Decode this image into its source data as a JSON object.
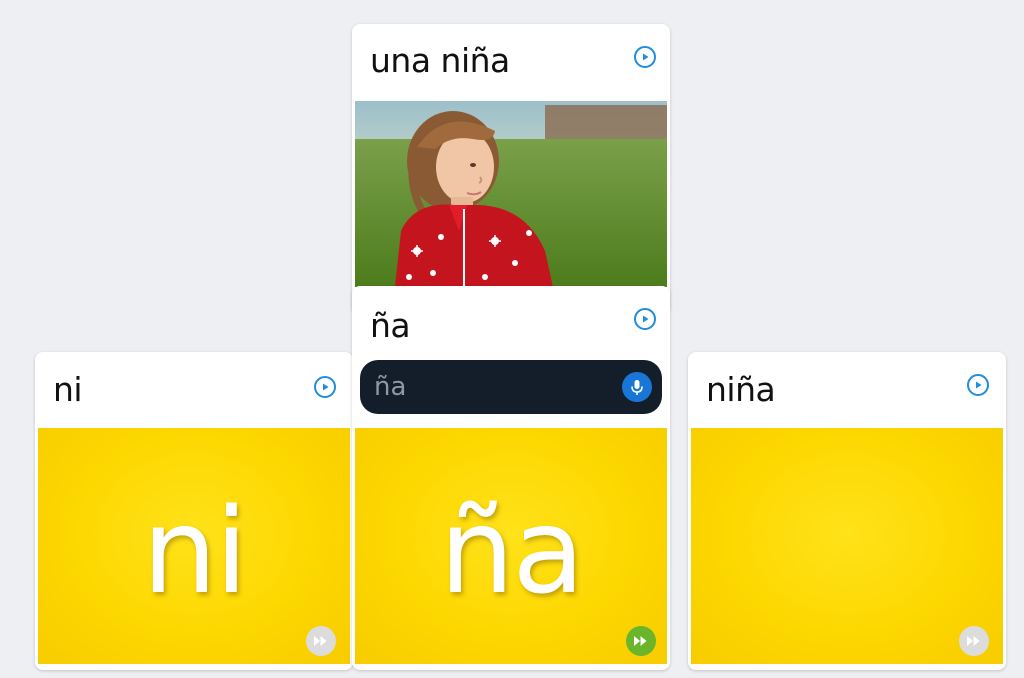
{
  "cards": {
    "left": {
      "title": "ni",
      "big_word": "ni"
    },
    "center_top": {
      "title": "una niña"
    },
    "center_bottom": {
      "title": "ña",
      "big_word": "ña",
      "mic_text": "ña"
    },
    "right": {
      "title": "niña"
    }
  },
  "icons": {
    "play": "play-circle-icon",
    "skip": "fast-forward-icon",
    "mic": "microphone-icon"
  },
  "colors": {
    "accent_blue": "#1e8ede",
    "card_yellow": "#fdd700",
    "skip_active": "#6bb52a",
    "skip_inactive": "#dcdcdc",
    "mic_bar": "#131e2a",
    "mic_button": "#1877d6"
  }
}
